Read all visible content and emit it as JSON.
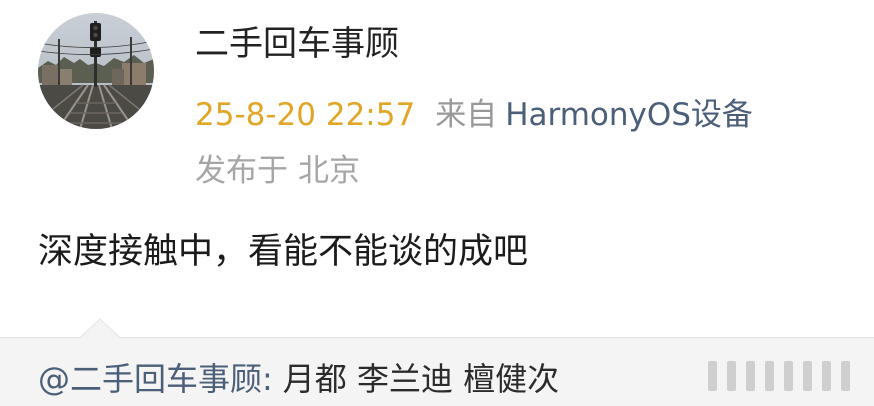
{
  "post": {
    "username": "二手回车事顾",
    "timestamp": "25-8-20 22:57",
    "source_prefix": "来自",
    "source_device": "HarmonyOS设备",
    "location_label": "发布于",
    "location_city": "北京",
    "text": "深度接触中，看能不能谈的成吧",
    "avatar_icon": "railway-track-avatar"
  },
  "repost": {
    "mention": "@二手回车事顾",
    "colon": ":",
    "text": "月都 李兰迪 檀健次"
  },
  "colors": {
    "timestamp": "#e2a526",
    "link": "#4b5f78",
    "muted": "#999999",
    "repost_background": "#f4f4f4"
  }
}
